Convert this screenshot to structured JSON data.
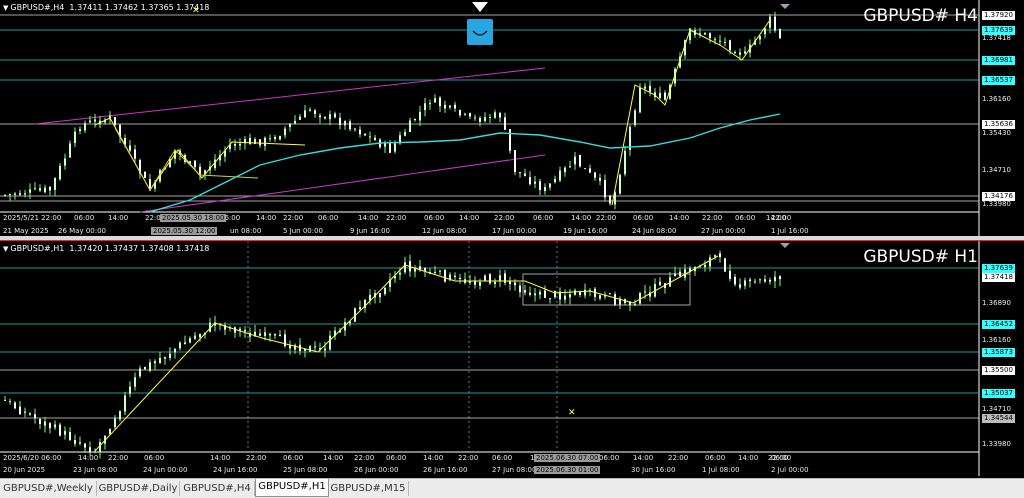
{
  "panes": [
    {
      "id": "h4",
      "header": "GBPUSD#,H4  1.37411 1.37462 1.37365 1.37418",
      "watermark": "GBPUSD# H4",
      "price_labels": [
        {
          "text": "1.37920",
          "style": "box-white"
        },
        {
          "text": "1.37639",
          "style": "box-cyan"
        },
        {
          "text": "1.37418",
          "style": "plain"
        },
        {
          "text": "1.36981",
          "style": "box-cyan"
        },
        {
          "text": "1.36537",
          "style": "box-cyan"
        },
        {
          "text": "1.36160",
          "style": "plain"
        },
        {
          "text": "1.35636",
          "style": "box-white"
        },
        {
          "text": "1.35430",
          "style": "plain"
        },
        {
          "text": "1.34710",
          "style": "plain"
        },
        {
          "text": "1.34176",
          "style": "box-white"
        },
        {
          "text": "1.33980",
          "style": "plain"
        }
      ],
      "time_row1": [
        "2025/5/21 22:00",
        "06:00",
        "14:00",
        "22:00",
        "06:00",
        "14:00",
        "22:00",
        "06:00",
        "14:00",
        "22:00",
        "06:00",
        "14:00",
        "22:00",
        "06:00",
        "14:00",
        "22:00",
        "06:00",
        "14:00",
        "22:00",
        "06:00",
        "14:00",
        "22:00"
      ],
      "time_row1_highlight": "2025.05.30 18:00",
      "time_row2": [
        "21 May 2025",
        "26 May 00:00",
        "28 M",
        "un 08:00",
        "5 Jun 00:00",
        "9 Jun 16:00",
        "12 Jun 08:00",
        "17 Jun 00:00",
        "19 Jun 16:00",
        "24 Jun 08:00",
        "27 Jun 00:00",
        "1 Jul 16:00"
      ],
      "time_row2_highlight": "2025.05.30 12:00"
    },
    {
      "id": "h1",
      "header": "GBPUSD#,H1  1.37420 1.37437 1.37408 1.37418",
      "watermark": "GBPUSD# H1",
      "price_labels": [
        {
          "text": "1.37639",
          "style": "box-cyan"
        },
        {
          "text": "1.37418",
          "style": "box-white"
        },
        {
          "text": "1.36890",
          "style": "plain"
        },
        {
          "text": "1.36452",
          "style": "box-cyan"
        },
        {
          "text": "1.36160",
          "style": "plain"
        },
        {
          "text": "1.35873",
          "style": "box-cyan"
        },
        {
          "text": "1.35500",
          "style": "box-white"
        },
        {
          "text": "1.35037",
          "style": "box-cyan"
        },
        {
          "text": "1.34710",
          "style": "plain"
        },
        {
          "text": "1.34544",
          "style": "box-grey"
        },
        {
          "text": "1.33980",
          "style": "plain"
        }
      ],
      "time_row1": [
        "2025/6/20 06:00",
        "14:00",
        "22:00",
        "06:00",
        "14:00",
        "22:00",
        "06:00",
        "14:00",
        "22:00",
        "06:00",
        "14:00",
        "22:00",
        "06:00",
        "14:00",
        "22:00",
        "06:00",
        "14:00",
        "22:00",
        "06:00",
        "14:00",
        "22:00",
        "06:00"
      ],
      "time_row1_highlight": "2025.06.30 07:00",
      "time_row2": [
        "20 Jun 2025",
        "23 Jun 08:00",
        "24 Jun 00:00",
        "24 Jun 16:00",
        "25 Jun 08:00",
        "26 Jun 00:00",
        "26 Jun 16:00",
        "27 Jun 08:00",
        "30 Jun 16:00",
        "1 Jul 08:00",
        "2 Jul 00:00"
      ],
      "time_row2_highlight": "2025.06.30 01:00"
    }
  ],
  "tabs": [
    {
      "label": "GBPUSD#,Weekly",
      "active": false
    },
    {
      "label": "GBPUSD#,Daily",
      "active": false
    },
    {
      "label": "GBPUSD#,H4",
      "active": false
    },
    {
      "label": "GBPUSD#,H1",
      "active": true
    },
    {
      "label": "GBPUSD#,M15",
      "active": false
    }
  ],
  "colors": {
    "bull": "#ccffcc",
    "bear": "#ffffff",
    "wick": "#7cff7c",
    "zigzag": "#ffff33",
    "ma": "#33dddd",
    "channel": "#cc33cc",
    "hline_white": "#dddddd",
    "hline_cyan": "#33cccc",
    "vline": "#6fa0b0",
    "box_cyan": "#33ffff",
    "box_white": "#ffffff",
    "box_grey": "#bbbbbb"
  }
}
